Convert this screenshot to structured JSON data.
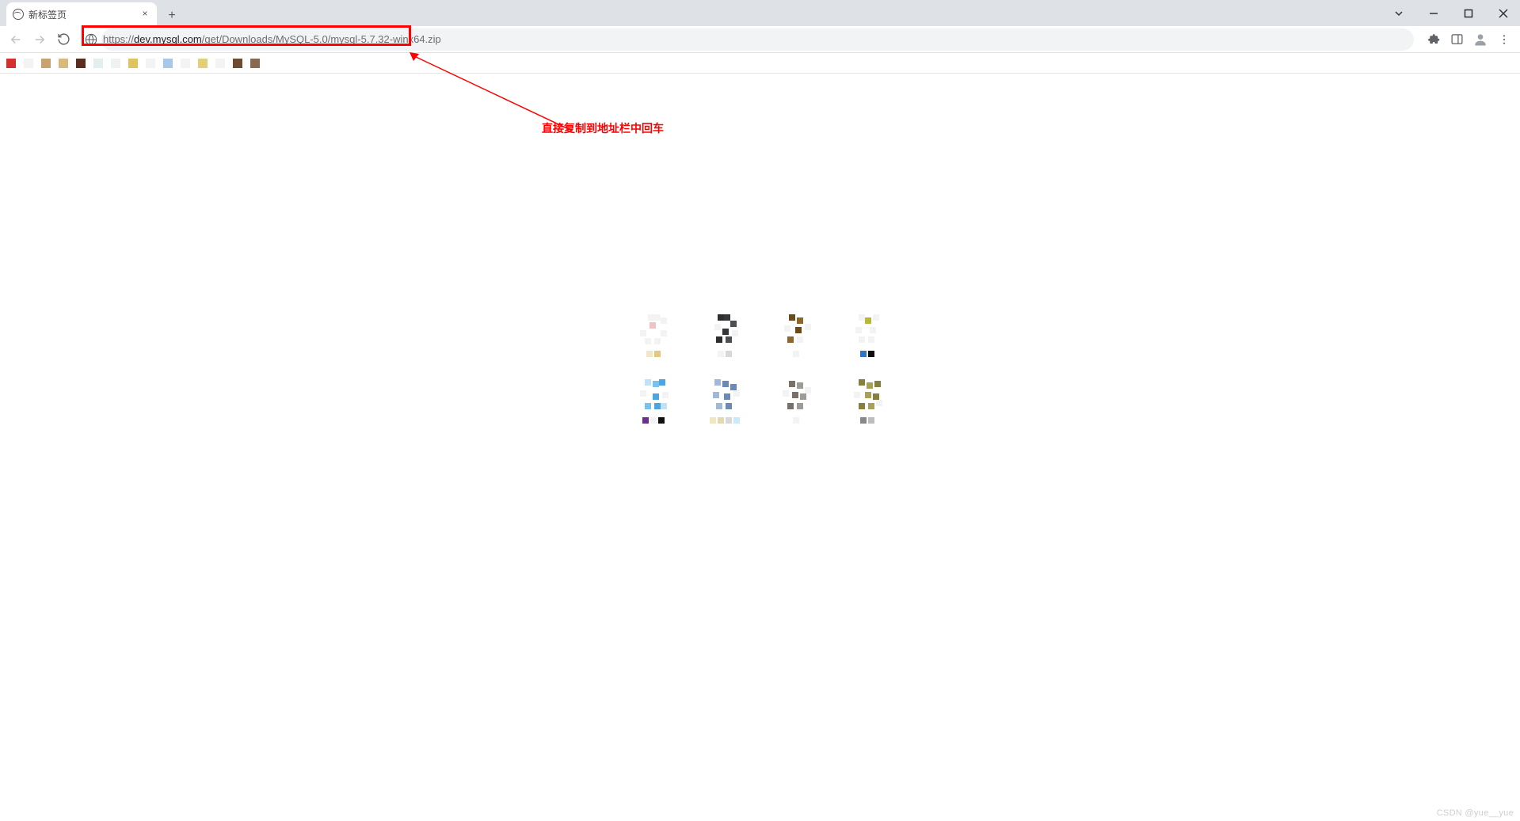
{
  "window": {
    "tab_title": "新标签页",
    "close_tab": "×",
    "new_tab": "+"
  },
  "toolbar": {
    "url_scheme": "https://",
    "url_host": "dev.mysql.com",
    "url_path": "/get/Downloads/MySQL-5.0/mysql-5.7.32-winx64.zip"
  },
  "annotation": {
    "text": "直接复制到地址栏中回车"
  },
  "watermark": "CSDN @yue__yue",
  "bookmarks_strip": {
    "colors": [
      "c-red",
      "c-ghost",
      "c-tan1",
      "c-tan2",
      "c-brown2",
      "c-lt1",
      "c-lt2",
      "c-yel1",
      "c-ghost",
      "c-lblue",
      "c-ghost",
      "c-yel2",
      "c-ghost",
      "c-br1",
      "c-br2"
    ]
  },
  "shortcuts": [
    {
      "icon": [
        [
          "c-ghost",
          16,
          6
        ],
        [
          "c-ghost",
          24,
          6
        ],
        [
          "c-ghost",
          32,
          10
        ],
        [
          "c-pink",
          18,
          16
        ],
        [
          "c-ghost",
          6,
          26
        ],
        [
          "c-ghost",
          32,
          26
        ],
        [
          "c-ghost",
          12,
          36
        ],
        [
          "c-ghost",
          24,
          36
        ]
      ],
      "label": [
        "c-lsand",
        "c-sand"
      ]
    },
    {
      "icon": [
        [
          "c-dk1",
          14,
          6
        ],
        [
          "c-dk2",
          22,
          6
        ],
        [
          "c-dk3",
          30,
          14
        ],
        [
          "c-ghost",
          10,
          18
        ],
        [
          "c-dk2",
          20,
          24
        ],
        [
          "c-ghost",
          32,
          26
        ],
        [
          "c-dk1",
          12,
          34
        ],
        [
          "c-dk3",
          24,
          34
        ]
      ],
      "label": [
        "c-ghost",
        "c-gray"
      ]
    },
    {
      "icon": [
        [
          "c-br3",
          14,
          6
        ],
        [
          "c-br4",
          24,
          10
        ],
        [
          "c-ghost",
          8,
          20
        ],
        [
          "c-br3",
          22,
          22
        ],
        [
          "c-ghost",
          34,
          18
        ],
        [
          "c-br4",
          12,
          34
        ],
        [
          "c-ghost",
          24,
          34
        ]
      ],
      "label": [
        "c-ghost"
      ]
    },
    {
      "icon": [
        [
          "c-ghost",
          12,
          6
        ],
        [
          "c-olive",
          20,
          10
        ],
        [
          "c-ghost",
          30,
          6
        ],
        [
          "c-ghost",
          8,
          22
        ],
        [
          "c-ghost",
          26,
          22
        ],
        [
          "c-ghost",
          12,
          34
        ],
        [
          "c-ghost",
          24,
          34
        ]
      ],
      "label": [
        "c-blue2",
        "c-blk"
      ]
    },
    {
      "icon": [
        [
          "c-skyl",
          12,
          4
        ],
        [
          "c-sky",
          22,
          6
        ],
        [
          "c-sky2",
          30,
          4
        ],
        [
          "c-ghost",
          6,
          18
        ],
        [
          "c-sky2",
          22,
          22
        ],
        [
          "c-ghost",
          34,
          20
        ],
        [
          "c-sky",
          12,
          34
        ],
        [
          "c-sky2",
          24,
          34
        ],
        [
          "c-skyl",
          32,
          34
        ]
      ],
      "label": [
        "c-purple",
        "c-ghost",
        "c-blk"
      ]
    },
    {
      "icon": [
        [
          "c-lblue2",
          10,
          4
        ],
        [
          "c-mblue",
          20,
          6
        ],
        [
          "c-mblue",
          30,
          10
        ],
        [
          "c-lblue2",
          8,
          20
        ],
        [
          "c-mblue",
          22,
          22
        ],
        [
          "c-ghost",
          34,
          18
        ],
        [
          "c-lblue2",
          12,
          34
        ],
        [
          "c-mblue",
          24,
          34
        ]
      ],
      "label": [
        "c-cream",
        "c-cream2",
        "c-gray",
        "c-ltsky"
      ]
    },
    {
      "icon": [
        [
          "c-gr1",
          14,
          6
        ],
        [
          "c-gr2",
          24,
          8
        ],
        [
          "c-ghost",
          6,
          18
        ],
        [
          "c-gr1",
          18,
          20
        ],
        [
          "c-gr2",
          28,
          22
        ],
        [
          "c-ghost",
          34,
          14
        ],
        [
          "c-gr1",
          12,
          34
        ],
        [
          "c-gr2",
          24,
          34
        ]
      ],
      "label": [
        "c-ghost"
      ]
    },
    {
      "icon": [
        [
          "c-ol1",
          12,
          4
        ],
        [
          "c-ol2",
          22,
          8
        ],
        [
          "c-ol1",
          32,
          6
        ],
        [
          "c-ghost",
          6,
          20
        ],
        [
          "c-ol2",
          20,
          20
        ],
        [
          "c-ol1",
          30,
          22
        ],
        [
          "c-ghost",
          34,
          30
        ],
        [
          "c-ol1",
          12,
          34
        ],
        [
          "c-ol2",
          24,
          34
        ]
      ],
      "label": [
        "c-g1",
        "c-g2"
      ]
    }
  ]
}
